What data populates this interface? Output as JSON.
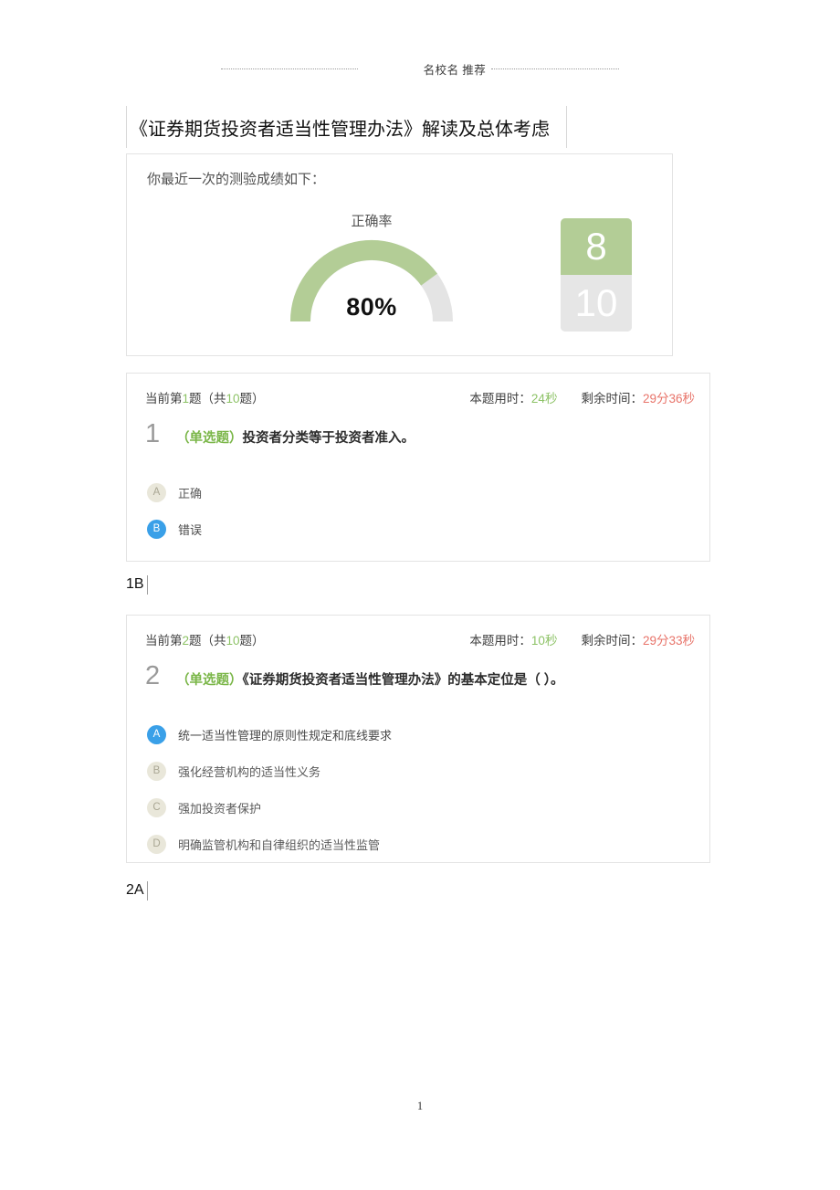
{
  "header": {
    "running_text": "名校名 推荐"
  },
  "title": {
    "text": "《证券期货投资者适当性管理办法》解读及总体考虑"
  },
  "score_card": {
    "caption": "你最近一次的测验成绩如下：",
    "gauge_label": "正确率",
    "gauge_value": "80%",
    "gauge_percent": 80,
    "correct": "8",
    "total": "10",
    "colors": {
      "green": "#b3cd96",
      "gray": "#e6e6e6"
    }
  },
  "questions": [
    {
      "meta_prefix": "当前第",
      "current": "1",
      "meta_mid": "题（共",
      "total": "10",
      "meta_suffix": "题）",
      "time_used_label": "本题用时：",
      "time_used_value": "24秒",
      "time_left_label": "剩余时间：",
      "time_left_value": "29分36秒",
      "index": "1",
      "type": "（单选题）",
      "text": "投资者分类等于投资者准入。",
      "options": [
        {
          "letter": "A",
          "text": "正确",
          "selected": false
        },
        {
          "letter": "B",
          "text": "错误",
          "selected": true
        }
      ],
      "typed_answer": "1B"
    },
    {
      "meta_prefix": "当前第",
      "current": "2",
      "meta_mid": "题（共",
      "total": "10",
      "meta_suffix": "题）",
      "time_used_label": "本题用时：",
      "time_used_value": "10秒",
      "time_left_label": "剩余时间：",
      "time_left_value": "29分33秒",
      "index": "2",
      "type": "（单选题）",
      "text": "《证券期货投资者适当性管理办法》的基本定位是（ ）。",
      "options": [
        {
          "letter": "A",
          "text": "统一适当性管理的原则性规定和底线要求",
          "selected": true
        },
        {
          "letter": "B",
          "text": "强化经营机构的适当性义务",
          "selected": false
        },
        {
          "letter": "C",
          "text": "强加投资者保护",
          "selected": false
        },
        {
          "letter": "D",
          "text": "明确监管机构和自律组织的适当性监管",
          "selected": false
        }
      ],
      "typed_answer": "2A"
    }
  ],
  "footer": {
    "page_number": "1"
  }
}
